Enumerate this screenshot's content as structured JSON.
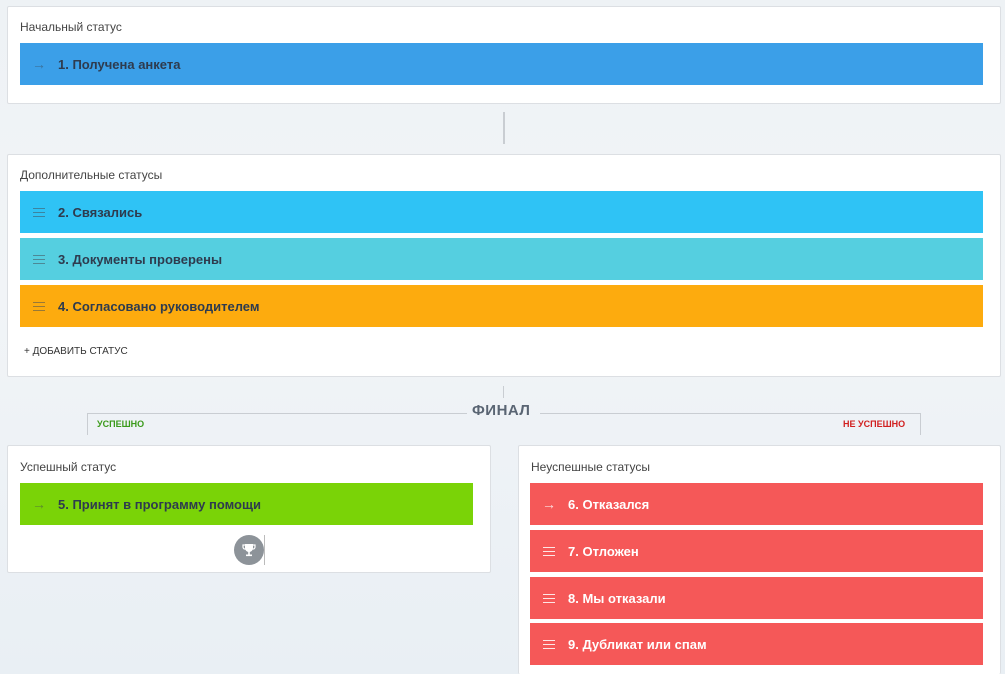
{
  "initial": {
    "title": "Начальный статус",
    "status": {
      "label": "1. Получена анкета",
      "color": "#3b9fe8",
      "icon": "arrow-icon"
    }
  },
  "additional": {
    "title": "Дополнительные статусы",
    "statuses": [
      {
        "label": "2. Связались",
        "color": "#2fc3f5",
        "icon": "drag-handle-icon"
      },
      {
        "label": "3. Документы проверены",
        "color": "#55cfe0",
        "icon": "drag-handle-icon"
      },
      {
        "label": "4. Согласовано руководителем",
        "color": "#fdab0e",
        "icon": "drag-handle-icon"
      }
    ],
    "add_label": "+ ДОБАВИТЬ СТАТУС"
  },
  "final": {
    "title": "ФИНАЛ",
    "success_tag": "УСПЕШНО",
    "fail_tag": "НЕ УСПЕШНО",
    "success_color": "#3a9a1a",
    "fail_color": "#d11f1f"
  },
  "success": {
    "title": "Успешный статус",
    "status": {
      "label": "5. Принят в программу помощи",
      "color": "#7ad307",
      "icon": "arrow-icon"
    },
    "trophy_icon": "trophy-icon"
  },
  "failure": {
    "title": "Неуспешные статусы",
    "statuses": [
      {
        "label": "6. Отказался",
        "color": "#f55858",
        "icon": "arrow-icon"
      },
      {
        "label": "7. Отложен",
        "color": "#f55858",
        "icon": "drag-handle-icon"
      },
      {
        "label": "8. Мы отказали",
        "color": "#f55858",
        "icon": "drag-handle-icon"
      },
      {
        "label": "9. Дубликат или спам",
        "color": "#f55858",
        "icon": "drag-handle-icon"
      }
    ]
  }
}
